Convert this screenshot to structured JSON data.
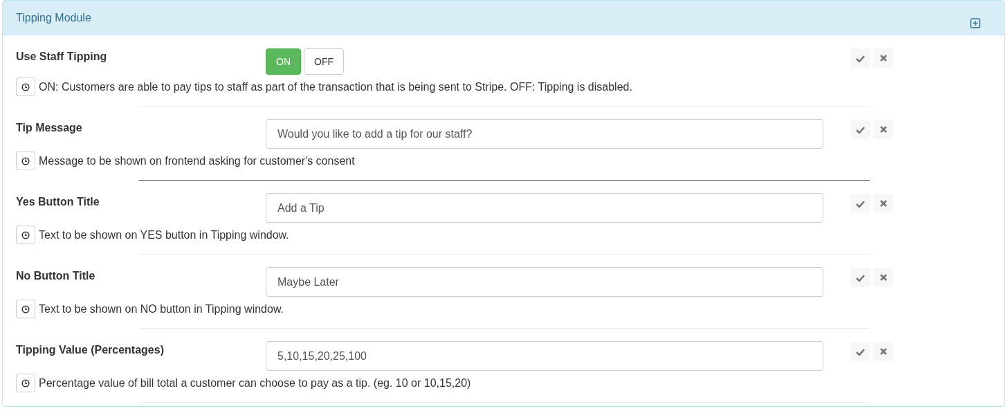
{
  "panel": {
    "title": "Tipping Module",
    "expanded": false
  },
  "settings": [
    {
      "kind": "toggle",
      "label": "Use Staff Tipping",
      "options": [
        {
          "label": "ON",
          "selected": true
        },
        {
          "label": "OFF",
          "selected": false
        }
      ],
      "help": "ON: Customers are able to pay tips to staff as part of the transaction that is being sent to Stripe. OFF: Tipping is disabled.",
      "divider_dark": false
    },
    {
      "kind": "text",
      "label": "Tip Message",
      "value": "Would you like to add a tip for our staff?",
      "help": "Message to be shown on frontend asking for customer's consent",
      "divider_dark": true
    },
    {
      "kind": "text",
      "label": "Yes Button Title",
      "value": "Add a Tip",
      "help": "Text to be shown on YES button in Tipping window.",
      "divider_dark": false
    },
    {
      "kind": "text",
      "label": "No Button Title",
      "value": "Maybe Later",
      "help": "Text to be shown on NO button in Tipping window.",
      "divider_dark": false
    },
    {
      "kind": "text",
      "label": "Tipping Value (Percentages)",
      "value": "5,10,15,20,25,100",
      "help": "Percentage value of bill total a customer can choose to pay as a tip. (eg. 10 or 10,15,20)",
      "divider_dark": false
    }
  ]
}
